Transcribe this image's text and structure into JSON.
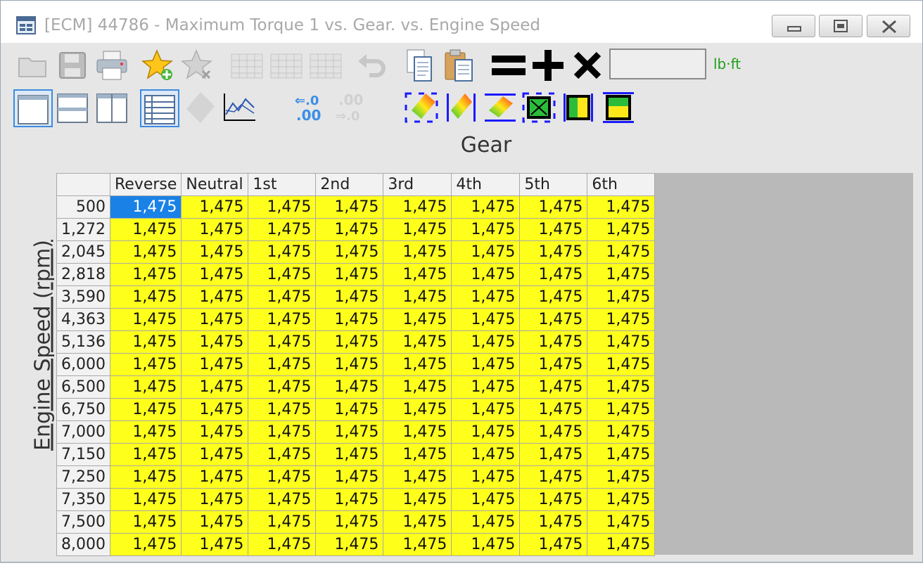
{
  "window": {
    "title": "[ECM] 44786 - Maximum Torque 1 vs. Gear. vs. Engine Speed"
  },
  "toolbar": {
    "icons_row1": [
      "open-folder-icon",
      "save-icon",
      "print-icon",
      "add-favorite-icon",
      "remove-favorite-icon",
      "table-a-icon",
      "table-b-icon",
      "table-c-icon",
      "undo-icon",
      "copy-icon",
      "paste-icon",
      "set-equal-icon",
      "add-icon",
      "multiply-icon"
    ],
    "unit_value": "",
    "unit_label": "lb·ft",
    "decimal_increase": ".0 .00",
    "decimal_decrease": ".00 .0"
  },
  "axes": {
    "x_label": "Gear",
    "y_label": "Engine Speed (rpm)"
  },
  "table": {
    "columns": [
      "Reverse",
      "Neutral",
      "1st",
      "2nd",
      "3rd",
      "4th",
      "5th",
      "6th"
    ],
    "rows": [
      {
        "rpm": "500",
        "values": [
          "1,475",
          "1,475",
          "1,475",
          "1,475",
          "1,475",
          "1,475",
          "1,475",
          "1,475"
        ]
      },
      {
        "rpm": "1,272",
        "values": [
          "1,475",
          "1,475",
          "1,475",
          "1,475",
          "1,475",
          "1,475",
          "1,475",
          "1,475"
        ]
      },
      {
        "rpm": "2,045",
        "values": [
          "1,475",
          "1,475",
          "1,475",
          "1,475",
          "1,475",
          "1,475",
          "1,475",
          "1,475"
        ]
      },
      {
        "rpm": "2,818",
        "values": [
          "1,475",
          "1,475",
          "1,475",
          "1,475",
          "1,475",
          "1,475",
          "1,475",
          "1,475"
        ]
      },
      {
        "rpm": "3,590",
        "values": [
          "1,475",
          "1,475",
          "1,475",
          "1,475",
          "1,475",
          "1,475",
          "1,475",
          "1,475"
        ]
      },
      {
        "rpm": "4,363",
        "values": [
          "1,475",
          "1,475",
          "1,475",
          "1,475",
          "1,475",
          "1,475",
          "1,475",
          "1,475"
        ]
      },
      {
        "rpm": "5,136",
        "values": [
          "1,475",
          "1,475",
          "1,475",
          "1,475",
          "1,475",
          "1,475",
          "1,475",
          "1,475"
        ]
      },
      {
        "rpm": "6,000",
        "values": [
          "1,475",
          "1,475",
          "1,475",
          "1,475",
          "1,475",
          "1,475",
          "1,475",
          "1,475"
        ]
      },
      {
        "rpm": "6,500",
        "values": [
          "1,475",
          "1,475",
          "1,475",
          "1,475",
          "1,475",
          "1,475",
          "1,475",
          "1,475"
        ]
      },
      {
        "rpm": "6,750",
        "values": [
          "1,475",
          "1,475",
          "1,475",
          "1,475",
          "1,475",
          "1,475",
          "1,475",
          "1,475"
        ]
      },
      {
        "rpm": "7,000",
        "values": [
          "1,475",
          "1,475",
          "1,475",
          "1,475",
          "1,475",
          "1,475",
          "1,475",
          "1,475"
        ]
      },
      {
        "rpm": "7,150",
        "values": [
          "1,475",
          "1,475",
          "1,475",
          "1,475",
          "1,475",
          "1,475",
          "1,475",
          "1,475"
        ]
      },
      {
        "rpm": "7,250",
        "values": [
          "1,475",
          "1,475",
          "1,475",
          "1,475",
          "1,475",
          "1,475",
          "1,475",
          "1,475"
        ]
      },
      {
        "rpm": "7,350",
        "values": [
          "1,475",
          "1,475",
          "1,475",
          "1,475",
          "1,475",
          "1,475",
          "1,475",
          "1,475"
        ]
      },
      {
        "rpm": "7,500",
        "values": [
          "1,475",
          "1,475",
          "1,475",
          "1,475",
          "1,475",
          "1,475",
          "1,475",
          "1,475"
        ]
      },
      {
        "rpm": "8,000",
        "values": [
          "1,475",
          "1,475",
          "1,475",
          "1,475",
          "1,475",
          "1,475",
          "1,475",
          "1,475"
        ]
      }
    ],
    "selected": {
      "row": 0,
      "col": 0
    }
  },
  "colors": {
    "cell": "#ffff1c",
    "selected": "#1a82e6",
    "unit_label": "#21a01b"
  }
}
